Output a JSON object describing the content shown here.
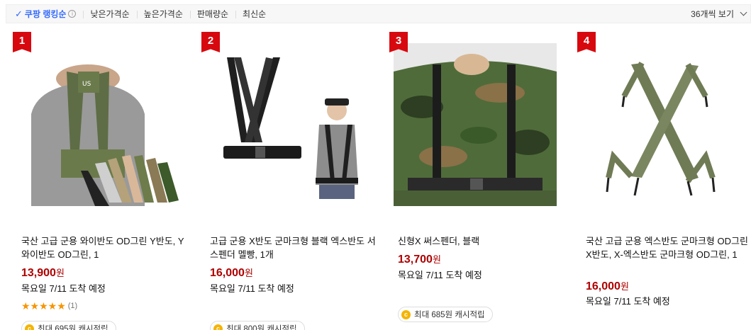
{
  "sortbar": {
    "ranking_label": "쿠팡 랭킹순",
    "low_price": "낮은가격순",
    "high_price": "높은가격순",
    "sales": "판매량순",
    "newest": "최신순",
    "per_page": "36개씩 보기"
  },
  "products": [
    {
      "rank": "1",
      "title": "국산 고급 군용 와이반도 OD그린 Y반도, Y 와이반도 OD그린, 1",
      "price": "13,900",
      "currency": "원",
      "delivery": "목요일 7/11 도착 예정",
      "rating": 5,
      "review_count": "(1)",
      "cashback": "최대 695원 캐시적립"
    },
    {
      "rank": "2",
      "title": "고급 군용 X반도 군마크형 블랙 엑스반도 서스펜더 멜빵, 1개",
      "price": "16,000",
      "currency": "원",
      "delivery": "목요일 7/11 도착 예정",
      "cashback": "최대 800원 캐시적립"
    },
    {
      "rank": "3",
      "title": "신형X 써스펜더, 블랙",
      "price": "13,700",
      "currency": "원",
      "delivery": "목요일 7/11 도착 예정",
      "cashback": "최대 685원 캐시적립"
    },
    {
      "rank": "4",
      "title": "국산 고급 군용 엑스반도 군마크형 OD그린 X반도, X-엑스반도 군마크형 OD그린, 1",
      "price": "16,000",
      "currency": "원",
      "delivery": "목요일 7/11 도착 예정"
    }
  ],
  "colors": {
    "accent": "#346aff",
    "price": "#ae0000",
    "rank_badge": "#d7090f",
    "star": "#f79400"
  }
}
